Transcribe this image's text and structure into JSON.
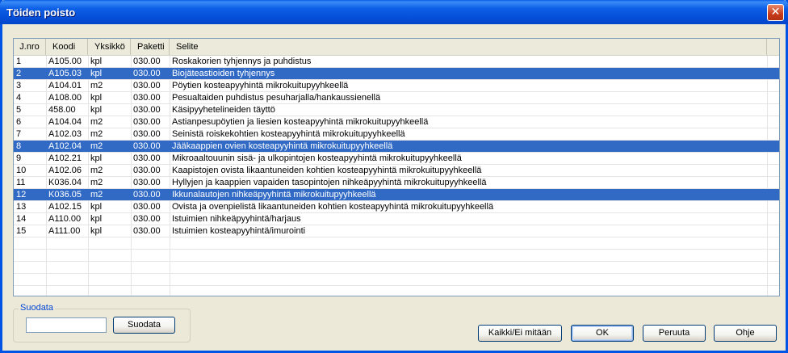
{
  "window": {
    "title": "Töiden poisto",
    "close_glyph": "✕"
  },
  "list": {
    "columns": [
      "J.nro",
      "Koodi",
      "Yksikkö",
      "Paketti",
      "Selite"
    ],
    "rows": [
      {
        "nro": "1",
        "code": "A105.00",
        "unit": "kpl",
        "pkg": "030.00",
        "desc": "Roskakorien tyhjennys ja puhdistus",
        "selected": false
      },
      {
        "nro": "2",
        "code": "A105.03",
        "unit": "kpl",
        "pkg": "030.00",
        "desc": "Biojäteastioiden tyhjennys",
        "selected": true
      },
      {
        "nro": "3",
        "code": "A104.01",
        "unit": "m2",
        "pkg": "030.00",
        "desc": "Pöytien kosteapyyhintä mikrokuitupyyhkeellä",
        "selected": false
      },
      {
        "nro": "4",
        "code": "A108.00",
        "unit": "kpl",
        "pkg": "030.00",
        "desc": "Pesualtaiden puhdistus pesuharjalla/hankaussienellä",
        "selected": false
      },
      {
        "nro": "5",
        "code": "458.00",
        "unit": "kpl",
        "pkg": "030.00",
        "desc": "Käsipyyhetelineiden täyttö",
        "selected": false
      },
      {
        "nro": "6",
        "code": "A104.04",
        "unit": "m2",
        "pkg": "030.00",
        "desc": "Astianpesupöytien ja liesien kosteapyyhintä mikrokuitupyyhkeellä",
        "selected": false
      },
      {
        "nro": "7",
        "code": "A102.03",
        "unit": "m2",
        "pkg": "030.00",
        "desc": "Seinistä roiskekohtien kosteapyyhintä mikrokuitupyyhkeellä",
        "selected": false
      },
      {
        "nro": "8",
        "code": "A102.04",
        "unit": "m2",
        "pkg": "030.00",
        "desc": "Jääkaappien ovien kosteapyyhintä mikrokuitupyyhkeellä",
        "selected": true
      },
      {
        "nro": "9",
        "code": "A102.21",
        "unit": "kpl",
        "pkg": "030.00",
        "desc": "Mikroaaltouunin sisä- ja ulkopintojen kosteapyyhintä mikrokuitupyyhkeellä",
        "selected": false
      },
      {
        "nro": "10",
        "code": "A102.06",
        "unit": "m2",
        "pkg": "030.00",
        "desc": "Kaapistojen ovista likaantuneiden kohtien kosteapyyhintä mikrokuitupyyhkeellä",
        "selected": false
      },
      {
        "nro": "11",
        "code": "K036.04",
        "unit": "m2",
        "pkg": "030.00",
        "desc": "Hyllyjen ja kaappien vapaiden tasopintojen nihkeäpyyhintä mikrokuitupyyhkeellä",
        "selected": false
      },
      {
        "nro": "12",
        "code": "K036.05",
        "unit": "m2",
        "pkg": "030.00",
        "desc": "Ikkunalautojen nihkeäpyyhintä mikrokuitupyyhkeellä",
        "selected": true
      },
      {
        "nro": "13",
        "code": "A102.15",
        "unit": "kpl",
        "pkg": "030.00",
        "desc": "Ovista ja ovenpielistä likaantuneiden kohtien kosteapyyhintä mikrokuitupyyhkeellä",
        "selected": false
      },
      {
        "nro": "14",
        "code": "A110.00",
        "unit": "kpl",
        "pkg": "030.00",
        "desc": "Istuimien nihkeäpyyhintä/harjaus",
        "selected": false
      },
      {
        "nro": "15",
        "code": "A111.00",
        "unit": "kpl",
        "pkg": "030.00",
        "desc": "Istuimien kosteapyyhintä/imurointi",
        "selected": false
      }
    ],
    "selected_bg": "#316ac5"
  },
  "filter": {
    "group_label": "Suodata",
    "input_value": "",
    "button_label": "Suodata"
  },
  "buttons": {
    "all_none": "Kaikki/Ei mitään",
    "ok": "OK",
    "cancel": "Peruuta",
    "help": "Ohje"
  }
}
